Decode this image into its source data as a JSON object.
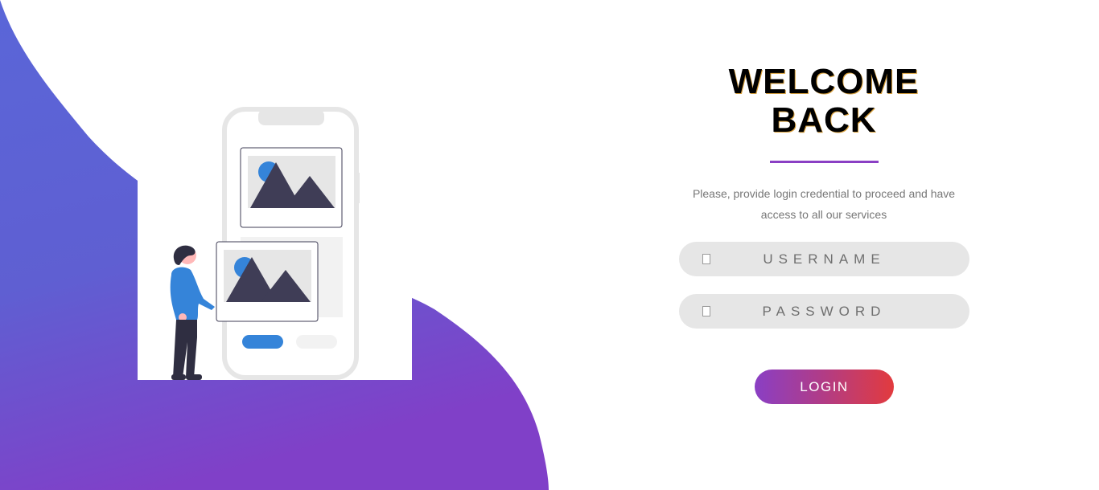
{
  "login": {
    "title_line1": "WELCOME",
    "title_line2": "BACK",
    "subtitle": "Please, provide login credential to proceed and have access to all our services",
    "username_placeholder": "USERNAME",
    "password_placeholder": "PASSWORD",
    "login_label": "LOGIN"
  },
  "icons": {
    "username": "user-icon",
    "password": "lock-icon"
  },
  "colors": {
    "accent": "#8a3fc4",
    "button_gradient_start": "#8a3fc4",
    "button_gradient_end": "#e23b3e",
    "blob_top": "#5b60d6",
    "blob_bottom": "#8040c8",
    "field_bg": "#e6e6e6"
  }
}
